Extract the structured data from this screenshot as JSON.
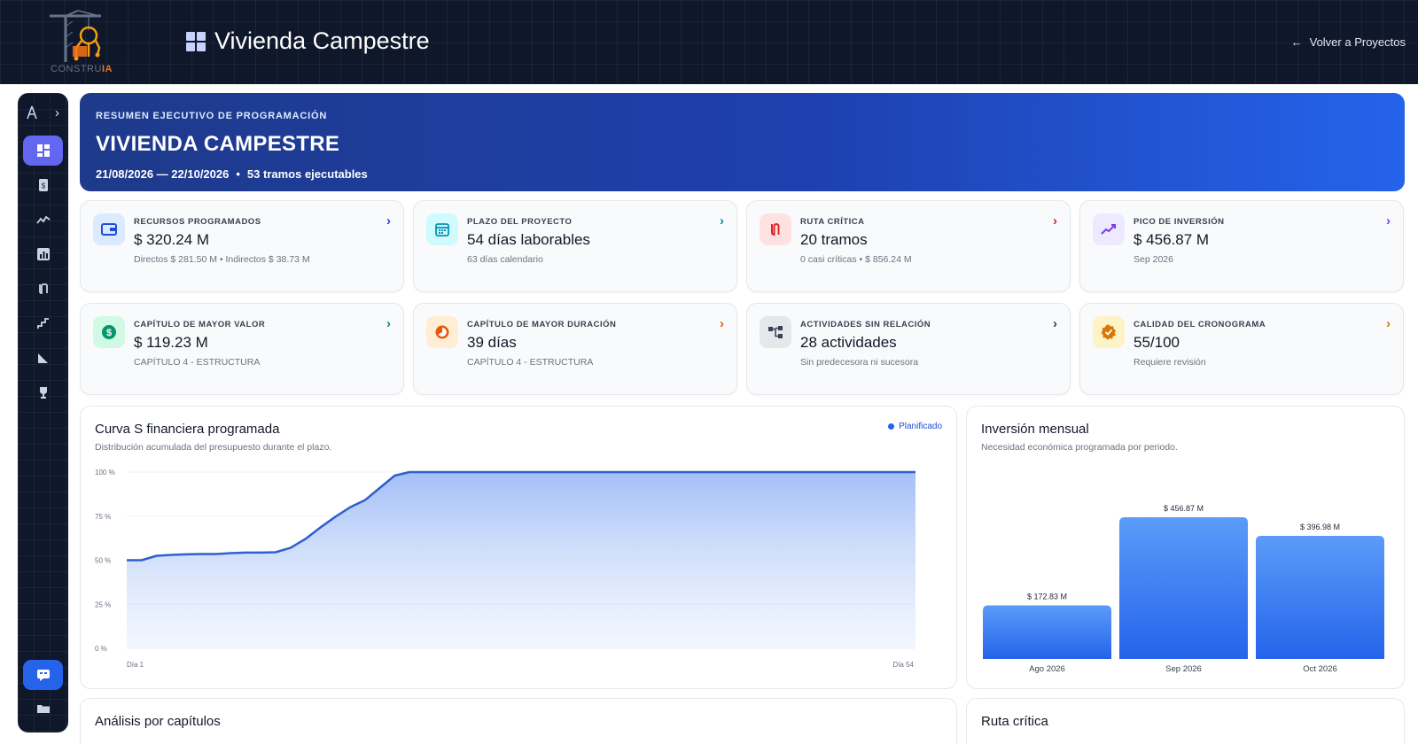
{
  "header": {
    "logo_text_main": "CONSTRU",
    "logo_text_accent": "IA",
    "title": "Vivienda Campestre",
    "back_label": "Volver a Proyectos"
  },
  "sidebar": {
    "items": [
      {
        "icon": "dashboard-icon",
        "active": true
      },
      {
        "icon": "document-dollar-icon"
      },
      {
        "icon": "trend-line-icon"
      },
      {
        "icon": "bar-chart-icon"
      },
      {
        "icon": "route-icon"
      },
      {
        "icon": "steps-icon"
      },
      {
        "icon": "ruler-triangle-icon"
      },
      {
        "icon": "trophy-icon"
      }
    ],
    "bottom_items": [
      {
        "icon": "chat-icon",
        "active": true
      },
      {
        "icon": "folder-icon"
      }
    ]
  },
  "hero": {
    "kicker": "RESUMEN EJECUTIVO DE PROGRAMACIÓN",
    "title": "VIVIENDA CAMPESTRE",
    "dates": "21/08/2026 — 22/10/2026",
    "separator": "•",
    "segments": "53 tramos ejecutables"
  },
  "kpis": [
    {
      "label": "RECURSOS PROGRAMADOS",
      "value": "$ 320.24 M",
      "sub": "Directos $ 281.50 M • Indirectos $ 38.73 M",
      "icon": "wallet-icon",
      "accent": "#1d4ed8",
      "bg": "#dbeafe"
    },
    {
      "label": "PLAZO DEL PROYECTO",
      "value": "54 días laborables",
      "sub": "63 días calendario",
      "icon": "calendar-icon",
      "accent": "#0891b2",
      "bg": "#cffafe"
    },
    {
      "label": "RUTA CRÍTICA",
      "value": "20 tramos",
      "sub": "0 casi críticas • $ 856.24 M",
      "icon": "route-icon",
      "accent": "#dc2626",
      "bg": "#fee2e2"
    },
    {
      "label": "PICO DE INVERSIÓN",
      "value": "$ 456.87 M",
      "sub": "Sep 2026",
      "icon": "trend-up-icon",
      "accent": "#7c3aed",
      "bg": "#ede9fe"
    },
    {
      "label": "CAPÍTULO DE MAYOR VALOR",
      "value": "$ 119.23 M",
      "sub": "CAPÍTULO 4 - ESTRUCTURA",
      "icon": "dollar-circle-icon",
      "accent": "#059669",
      "bg": "#d1fae5"
    },
    {
      "label": "CAPÍTULO DE MAYOR DURACIÓN",
      "value": "39 días",
      "sub": "CAPÍTULO 4 - ESTRUCTURA",
      "icon": "timer-icon",
      "accent": "#ea580c",
      "bg": "#ffedd5"
    },
    {
      "label": "ACTIVIDADES SIN RELACIÓN",
      "value": "28 actividades",
      "sub": "Sin predecesora ni sucesora",
      "icon": "network-icon",
      "accent": "#374151",
      "bg": "#e5e7eb"
    },
    {
      "label": "CALIDAD DEL CRONOGRAMA",
      "value": "55/100",
      "sub": "Requiere revisión",
      "icon": "badge-check-icon",
      "accent": "#d97706",
      "bg": "#fef3c7"
    }
  ],
  "scurve": {
    "title": "Curva S financiera programada",
    "subtitle": "Distribución acumulada del presupuesto durante el plazo.",
    "legend": "Planificado"
  },
  "monthly": {
    "title": "Inversión mensual",
    "subtitle": "Necesidad económica programada por periodo."
  },
  "bottom": {
    "chapters_title": "Análisis por capítulos",
    "critical_title": "Ruta crítica"
  },
  "chart_data": [
    {
      "type": "area",
      "title": "Curva S financiera programada",
      "series": [
        {
          "name": "Planificado",
          "values": [
            50,
            50,
            52.5,
            53,
            53.3,
            53.5,
            53.5,
            54,
            54.3,
            54.3,
            54.5,
            57,
            62,
            68.5,
            74.5,
            80,
            84,
            91,
            98,
            100,
            100,
            100,
            100,
            100,
            100,
            100,
            100,
            100,
            100,
            100,
            100,
            100,
            100,
            100,
            100,
            100,
            100,
            100,
            100,
            100,
            100,
            100,
            100,
            100,
            100,
            100,
            100,
            100,
            100,
            100,
            100,
            100,
            100,
            100
          ]
        }
      ],
      "x_start_label": "Día 1",
      "x_end_label": "Día 54",
      "y_ticks": [
        "0 %",
        "25 %",
        "50 %",
        "75 %",
        "100 %"
      ],
      "ylim": [
        0,
        100
      ],
      "grid": true,
      "legend": "top-right"
    },
    {
      "type": "bar",
      "title": "Inversión mensual",
      "categories": [
        "Ago 2026",
        "Sep 2026",
        "Oct 2026"
      ],
      "values": [
        172.83,
        456.87,
        396.98
      ],
      "value_labels": [
        "$ 172.83 M",
        "$ 456.87 M",
        "$ 396.98 M"
      ],
      "unit": "M"
    }
  ]
}
